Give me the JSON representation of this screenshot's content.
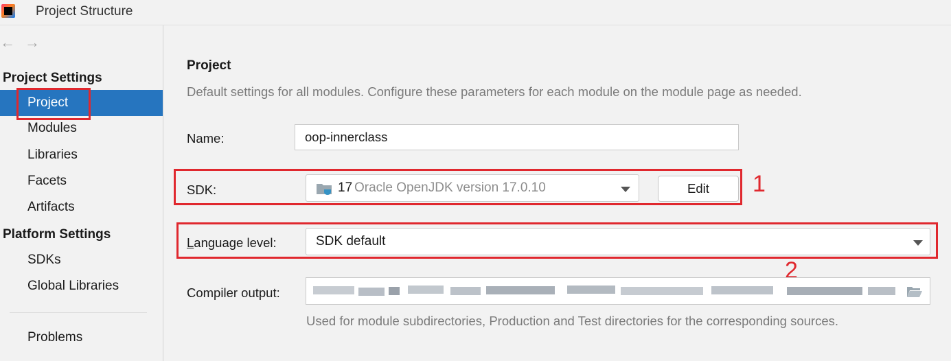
{
  "window": {
    "title": "Project Structure",
    "logo_icon": "intellij-logo-icon"
  },
  "nav": {
    "back_icon": "arrow-left-icon",
    "forward_icon": "arrow-right-icon"
  },
  "sidebar": {
    "project_settings_header": "Project Settings",
    "project_settings_items": [
      {
        "label": "Project",
        "selected": true
      },
      {
        "label": "Modules"
      },
      {
        "label": "Libraries"
      },
      {
        "label": "Facets"
      },
      {
        "label": "Artifacts"
      }
    ],
    "platform_settings_header": "Platform Settings",
    "platform_settings_items": [
      {
        "label": "SDKs"
      },
      {
        "label": "Global Libraries"
      }
    ],
    "problems_label": "Problems"
  },
  "main": {
    "title": "Project",
    "description": "Default settings for all modules. Configure these parameters for each module on the module page as needed.",
    "name_label": "Name:",
    "name_value": "oop-innerclass",
    "sdk_label": "SDK:",
    "sdk_version": "17",
    "sdk_name": "Oracle OpenJDK version 17.0.10",
    "sdk_icon": "jdk-folder-icon",
    "edit_label": "Edit",
    "language_level_label_mnemonic": "L",
    "language_level_label_rest": "anguage level:",
    "language_level_value": "SDK default",
    "compiler_output_label": "Compiler output:",
    "compiler_output_icon": "folder-open-icon",
    "compiler_output_hint": "Used for module subdirectories, Production and Test directories for the corresponding sources."
  },
  "annotations": {
    "sdk_marker": "1",
    "language_level_marker": "2",
    "highlight_color": "#e0282e"
  },
  "colors": {
    "selection": "#2675bf",
    "background": "#f2f2f2"
  }
}
